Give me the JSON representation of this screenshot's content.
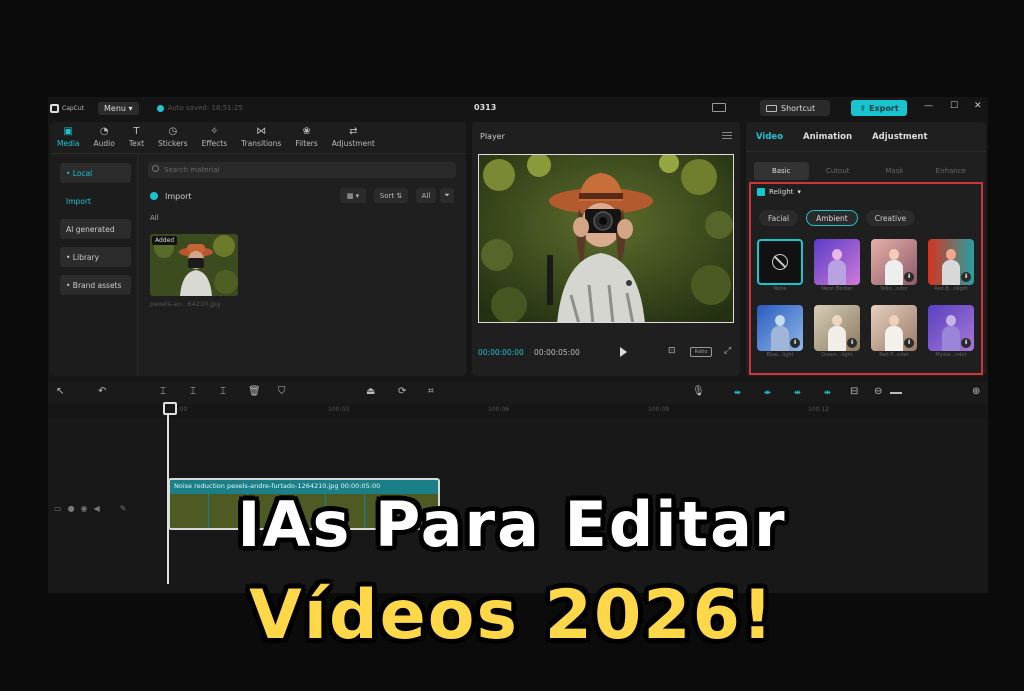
{
  "topbar": {
    "app_name": "CapCut",
    "menu_label": "Menu",
    "autosave_text": "Auto saved: 18:51:25",
    "project_title": "0313",
    "shortcut_label": "Shortcut",
    "export_label": "Export"
  },
  "media": {
    "tabs": [
      {
        "label": "Media",
        "icon": "media-icon"
      },
      {
        "label": "Audio",
        "icon": "audio-icon"
      },
      {
        "label": "Text",
        "icon": "text-icon"
      },
      {
        "label": "Stickers",
        "icon": "stickers-icon"
      },
      {
        "label": "Effects",
        "icon": "effects-icon"
      },
      {
        "label": "Transitions",
        "icon": "transitions-icon"
      },
      {
        "label": "Filters",
        "icon": "filters-icon"
      },
      {
        "label": "Adjustment",
        "icon": "adjustment-icon"
      }
    ],
    "side_nav": [
      "• Local",
      "Import",
      "AI generated",
      "• Library",
      "• Brand assets"
    ],
    "search_placeholder": "Search material",
    "import_label": "Import",
    "sort_label": "Sort",
    "filter_all_label": "All",
    "all_label": "All",
    "thumb_badge": "Added",
    "thumb_name": "pexels-an...64210.jpg"
  },
  "player": {
    "title": "Player",
    "current_time": "00:00:00:00",
    "total_time": "00:00:05:00",
    "ratio_label": "Ratio"
  },
  "details": {
    "tabs": [
      "Video",
      "Animation",
      "Adjustment"
    ],
    "sub_tabs": [
      "Basic",
      "Cutout",
      "Mask",
      "Enhance"
    ],
    "relight_title": "Relight",
    "relight_pills": [
      "Facial",
      "Ambient",
      "Creative"
    ],
    "presets": [
      {
        "name": "None"
      },
      {
        "name": "Neon Border"
      },
      {
        "name": "Yello...ndor"
      },
      {
        "name": "Red B...nlight"
      },
      {
        "name": "Blue...light"
      },
      {
        "name": "Green...light"
      },
      {
        "name": "Red P...ndor"
      },
      {
        "name": "Myste...ndor"
      }
    ]
  },
  "timeline": {
    "ruler": [
      "00:00",
      "100:03",
      "100:06",
      "100:09",
      "100:12"
    ],
    "clip_label": "Noise reduction  pexels-andre-furtado-1264210.jpg  00:00:05:00"
  },
  "headline": {
    "line1": "IAs Para Editar",
    "line2": "Vídeos 2026!"
  },
  "colors": {
    "accent": "#19c4d1",
    "highlight_border": "#d0343b",
    "headline_yellow": "#ffd84a"
  }
}
